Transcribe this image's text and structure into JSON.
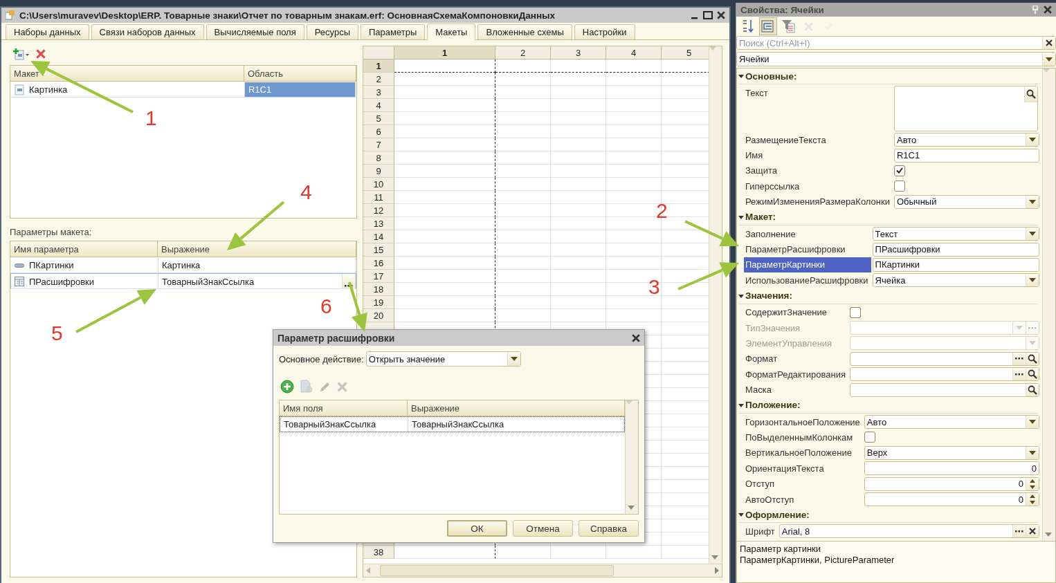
{
  "window": {
    "title": "C:\\Users\\muravev\\Desktop\\ERP. Товарные знаки\\Отчет по товарным знакам.erf: ОсновнаяСхемаКомпоновкиДанных"
  },
  "tabs": [
    {
      "label": "Наборы данных",
      "selected": false
    },
    {
      "label": "Связи наборов данных",
      "selected": false
    },
    {
      "label": "Вычисляемые поля",
      "selected": false
    },
    {
      "label": "Ресурсы",
      "selected": false
    },
    {
      "label": "Параметры",
      "selected": false
    },
    {
      "label": "Макеты",
      "selected": true
    },
    {
      "label": "Вложенные схемы",
      "selected": false
    },
    {
      "label": "Настройки",
      "selected": false
    }
  ],
  "toolbar": [
    {
      "kind": "add"
    },
    {
      "kind": "delete"
    }
  ],
  "templates_table": {
    "columns": [
      "Макет",
      "Область"
    ],
    "rows": [
      {
        "kind": "template",
        "cells": [
          "Картинка",
          "R1C1"
        ],
        "selected": true
      }
    ]
  },
  "parameters": {
    "label": "Параметры макета:",
    "columns": [
      "Имя параметра",
      "Выражение"
    ],
    "rows": [
      {
        "kind": "field",
        "cells": [
          "ПКартинки",
          "Картинка"
        ],
        "selected": false
      },
      {
        "kind": "table",
        "cells": [
          "ПРасшифровки",
          "ТоварныйЗнакСсылка"
        ],
        "selected": true
      }
    ]
  },
  "spreadsheet": {
    "columns": [
      {
        "label": "1",
        "selected": true
      },
      {
        "label": "2",
        "selected": false
      },
      {
        "label": "3",
        "selected": false
      },
      {
        "label": "4",
        "selected": false
      },
      {
        "label": "5",
        "selected": false
      }
    ],
    "rows_top": [
      {
        "label": "1",
        "selected": true
      },
      {
        "label": "2",
        "selected": false
      },
      {
        "label": "3",
        "selected": false
      },
      {
        "label": "4",
        "selected": false
      },
      {
        "label": "5",
        "selected": false
      },
      {
        "label": "6",
        "selected": false
      },
      {
        "label": "7",
        "selected": false
      },
      {
        "label": "8",
        "selected": false
      },
      {
        "label": "9",
        "selected": false
      },
      {
        "label": "10",
        "selected": false
      },
      {
        "label": "11",
        "selected": false
      },
      {
        "label": "12",
        "selected": false
      },
      {
        "label": "13",
        "selected": false
      },
      {
        "label": "14",
        "selected": false
      },
      {
        "label": "15",
        "selected": false
      },
      {
        "label": "16",
        "selected": false
      },
      {
        "label": "17",
        "selected": false
      },
      {
        "label": "18",
        "selected": false
      },
      {
        "label": "19",
        "selected": false
      },
      {
        "label": "20",
        "selected": false
      }
    ],
    "rows_bottom": [
      {
        "label": "38",
        "selected": false
      }
    ]
  },
  "dialog": {
    "title": "Параметр расшифровки",
    "action_label": "Основное действие:",
    "action_value": "Открыть значение",
    "toolbar": [
      {
        "kind": "add",
        "disabled": false
      },
      {
        "kind": "copy",
        "disabled": true
      },
      {
        "kind": "edit",
        "disabled": true
      },
      {
        "kind": "delete",
        "disabled": true
      }
    ],
    "columns": [
      "Имя поля",
      "Выражение"
    ],
    "rows": [
      {
        "cells": [
          "ТоварныйЗнакСсылка",
          "ТоварныйЗнакСсылка"
        ],
        "selected": true
      }
    ],
    "buttons": [
      {
        "label": "ОК",
        "default": true
      },
      {
        "label": "Отмена",
        "default": false
      },
      {
        "label": "Справка",
        "default": false
      }
    ]
  },
  "properties": {
    "title": "Свойства: Ячейки",
    "toolbar": [
      {
        "kind": "sort",
        "selected": false,
        "disabled": false
      },
      {
        "kind": "categories",
        "selected": true,
        "disabled": false
      },
      {
        "kind": "filter",
        "selected": false,
        "disabled": false
      },
      {
        "kind": "cancel",
        "selected": false,
        "disabled": true
      },
      {
        "kind": "apply",
        "selected": false,
        "disabled": true
      }
    ],
    "search_placeholder": "Поиск (Ctrl+Alt+I)",
    "object": "Ячейки",
    "sections": [
      {
        "title": "Основные:",
        "expanded": true,
        "rows": [
          {
            "label": "Текст",
            "kind": "memo",
            "search": true,
            "selected": false,
            "disabled": false
          },
          {
            "label": "РазмещениеТекста",
            "kind": "select",
            "value": "Авто",
            "selected": false,
            "disabled": false
          },
          {
            "label": "Имя",
            "kind": "text",
            "value": "R1C1",
            "selected": false,
            "disabled": false
          },
          {
            "label": "Защита",
            "kind": "checkbox",
            "checked": true,
            "selected": false,
            "disabled": false
          },
          {
            "label": "Гиперссылка",
            "kind": "checkbox",
            "checked": false,
            "selected": false,
            "disabled": false
          },
          {
            "label": "РежимИзмененияРазмераКолонки",
            "kind": "select",
            "value": "Обычный",
            "selected": false,
            "disabled": false
          }
        ]
      },
      {
        "title": "Макет:",
        "expanded": true,
        "rows": [
          {
            "label": "Заполнение",
            "kind": "select",
            "value": "Текст",
            "selected": false,
            "disabled": false
          },
          {
            "label": "ПараметрРасшифровки",
            "kind": "text",
            "value": "ПРасшифровки",
            "selected": false,
            "disabled": false
          },
          {
            "label": "ПараметрКартинки",
            "kind": "text",
            "value": "ПКартинки",
            "selected": true,
            "disabled": false
          },
          {
            "label": "ИспользованиеРасшифровки",
            "kind": "select",
            "value": "Ячейка",
            "selected": false,
            "disabled": false
          }
        ]
      },
      {
        "title": "Значения:",
        "expanded": true,
        "rows": [
          {
            "label": "СодержитЗначение",
            "kind": "checkbox",
            "checked": false,
            "selected": false,
            "disabled": false
          },
          {
            "label": "ТипЗначения",
            "kind": "select",
            "ellipsis": true,
            "selected": false,
            "disabled": true
          },
          {
            "label": "ЭлементУправления",
            "kind": "select",
            "selected": false,
            "disabled": true
          },
          {
            "label": "Формат",
            "kind": "text",
            "ellipsis": true,
            "search": true,
            "selected": false,
            "disabled": false
          },
          {
            "label": "ФорматРедактирования",
            "kind": "text",
            "ellipsis": true,
            "search": true,
            "selected": false,
            "disabled": false
          },
          {
            "label": "Маска",
            "kind": "text",
            "search": true,
            "selected": false,
            "disabled": false
          }
        ]
      },
      {
        "title": "Положение:",
        "expanded": true,
        "rows": [
          {
            "label": "ГоризонтальноеПоложение",
            "kind": "select",
            "value": "Авто",
            "selected": false,
            "disabled": false
          },
          {
            "label": "ПоВыделеннымКолонкам",
            "kind": "checkbox",
            "checked": false,
            "selected": false,
            "disabled": false
          },
          {
            "label": "ВертикальноеПоложение",
            "kind": "select",
            "value": "Верх",
            "selected": false,
            "disabled": false
          },
          {
            "label": "ОриентацияТекста",
            "kind": "number",
            "value": "0",
            "selected": false,
            "disabled": false
          },
          {
            "label": "Отступ",
            "kind": "spin",
            "value": "0",
            "selected": false,
            "disabled": false
          },
          {
            "label": "АвтоОтступ",
            "kind": "spin",
            "value": "0",
            "selected": false,
            "disabled": false
          }
        ]
      },
      {
        "title": "Оформление:",
        "expanded": true,
        "rows": [
          {
            "label": "Шрифт",
            "kind": "text",
            "value": "Arial, 8",
            "ellipsis": true,
            "clear": true,
            "selected": false,
            "disabled": false
          }
        ]
      }
    ],
    "description": [
      "Параметр картинки",
      "ПараметрКартинки, PictureParameter"
    ]
  },
  "annotations": [
    {
      "label": "1"
    },
    {
      "label": "2"
    },
    {
      "label": "3"
    },
    {
      "label": "4"
    },
    {
      "label": "5"
    },
    {
      "label": "6"
    }
  ]
}
